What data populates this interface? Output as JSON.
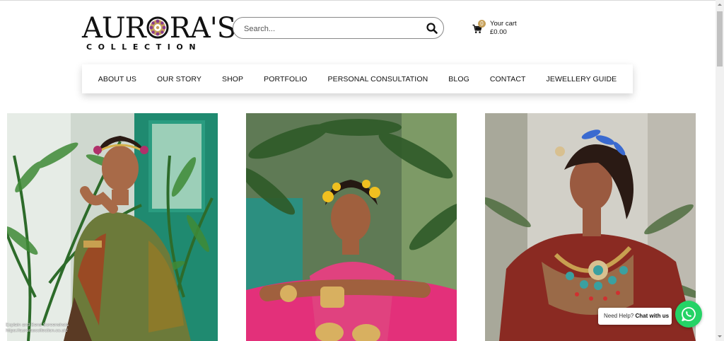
{
  "header": {
    "logo": {
      "word_pre": "AUR",
      "word_post": "RA'S",
      "sub": "COLLECTION"
    },
    "search": {
      "placeholder": "Search...",
      "icon": "search-icon"
    },
    "cart": {
      "count": "0",
      "label": "Your cart",
      "total": "£0.00",
      "icon": "cart-icon"
    }
  },
  "nav": {
    "items": [
      {
        "label": "ABOUT US"
      },
      {
        "label": "OUR STORY"
      },
      {
        "label": "SHOP"
      },
      {
        "label": "PORTFOLIO"
      },
      {
        "label": "PERSONAL CONSULTATION"
      },
      {
        "label": "BLOG"
      },
      {
        "label": "CONTACT"
      },
      {
        "label": "JEWELLERY GUIDE"
      }
    ]
  },
  "gallery": {
    "photos": [
      {
        "icon": "model-photo-1"
      },
      {
        "icon": "model-photo-2"
      },
      {
        "icon": "model-photo-3"
      }
    ],
    "watermark": {
      "line1": "Explain and Send Screenshots",
      "line2": "https://aurorascollection.co.uk/"
    }
  },
  "chat": {
    "prefix": "Need Help?",
    "cta": "Chat with us",
    "icon": "whatsapp-icon"
  },
  "colors": {
    "accent_gold": "#c6a15b",
    "whatsapp_green": "#25d366",
    "logo_black": "#111111"
  }
}
